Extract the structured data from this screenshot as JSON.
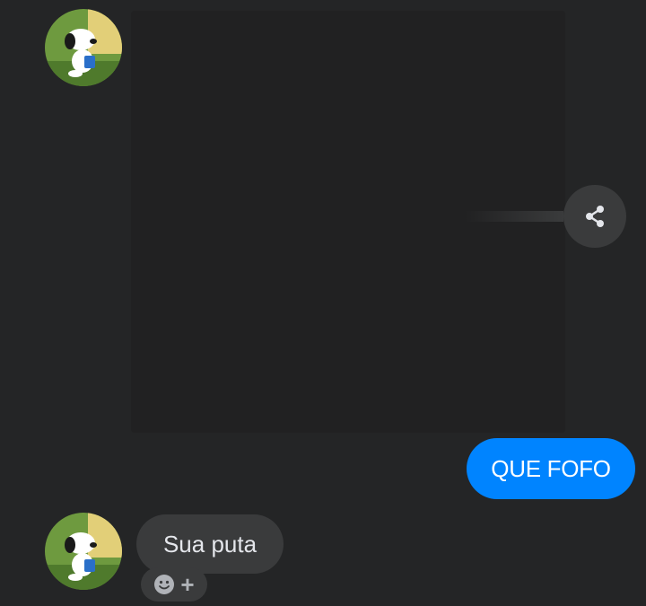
{
  "messages": {
    "sent": {
      "text": "QUE FOFO",
      "color": "#0084ff"
    },
    "received": {
      "text": "Sua puta",
      "color": "#3a3b3c"
    }
  },
  "icons": {
    "share": "share-icon",
    "reaction": "smiley-icon",
    "add": "+"
  },
  "avatar": {
    "description_icon": "snoopy-avatar-icon",
    "bg_left": "#5f8a3a",
    "bg_right": "#e8d27a"
  },
  "theme": {
    "background": "#242526",
    "bubble_received": "#3a3b3c",
    "bubble_sent": "#0084ff"
  }
}
